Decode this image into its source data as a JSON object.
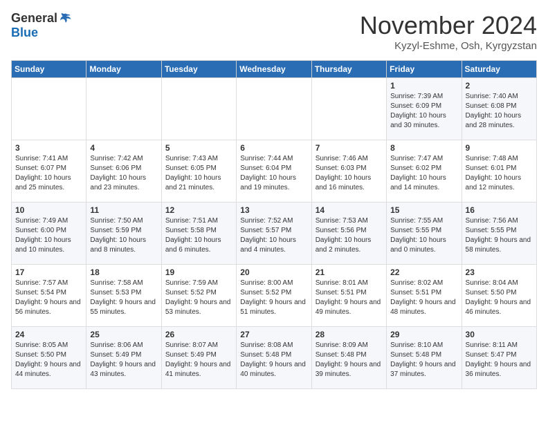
{
  "header": {
    "logo_general": "General",
    "logo_blue": "Blue",
    "title": "November 2024",
    "location": "Kyzyl-Eshme, Osh, Kyrgyzstan"
  },
  "days_of_week": [
    "Sunday",
    "Monday",
    "Tuesday",
    "Wednesday",
    "Thursday",
    "Friday",
    "Saturday"
  ],
  "weeks": [
    [
      {
        "day": "",
        "info": ""
      },
      {
        "day": "",
        "info": ""
      },
      {
        "day": "",
        "info": ""
      },
      {
        "day": "",
        "info": ""
      },
      {
        "day": "",
        "info": ""
      },
      {
        "day": "1",
        "info": "Sunrise: 7:39 AM\nSunset: 6:09 PM\nDaylight: 10 hours and 30 minutes."
      },
      {
        "day": "2",
        "info": "Sunrise: 7:40 AM\nSunset: 6:08 PM\nDaylight: 10 hours and 28 minutes."
      }
    ],
    [
      {
        "day": "3",
        "info": "Sunrise: 7:41 AM\nSunset: 6:07 PM\nDaylight: 10 hours and 25 minutes."
      },
      {
        "day": "4",
        "info": "Sunrise: 7:42 AM\nSunset: 6:06 PM\nDaylight: 10 hours and 23 minutes."
      },
      {
        "day": "5",
        "info": "Sunrise: 7:43 AM\nSunset: 6:05 PM\nDaylight: 10 hours and 21 minutes."
      },
      {
        "day": "6",
        "info": "Sunrise: 7:44 AM\nSunset: 6:04 PM\nDaylight: 10 hours and 19 minutes."
      },
      {
        "day": "7",
        "info": "Sunrise: 7:46 AM\nSunset: 6:03 PM\nDaylight: 10 hours and 16 minutes."
      },
      {
        "day": "8",
        "info": "Sunrise: 7:47 AM\nSunset: 6:02 PM\nDaylight: 10 hours and 14 minutes."
      },
      {
        "day": "9",
        "info": "Sunrise: 7:48 AM\nSunset: 6:01 PM\nDaylight: 10 hours and 12 minutes."
      }
    ],
    [
      {
        "day": "10",
        "info": "Sunrise: 7:49 AM\nSunset: 6:00 PM\nDaylight: 10 hours and 10 minutes."
      },
      {
        "day": "11",
        "info": "Sunrise: 7:50 AM\nSunset: 5:59 PM\nDaylight: 10 hours and 8 minutes."
      },
      {
        "day": "12",
        "info": "Sunrise: 7:51 AM\nSunset: 5:58 PM\nDaylight: 10 hours and 6 minutes."
      },
      {
        "day": "13",
        "info": "Sunrise: 7:52 AM\nSunset: 5:57 PM\nDaylight: 10 hours and 4 minutes."
      },
      {
        "day": "14",
        "info": "Sunrise: 7:53 AM\nSunset: 5:56 PM\nDaylight: 10 hours and 2 minutes."
      },
      {
        "day": "15",
        "info": "Sunrise: 7:55 AM\nSunset: 5:55 PM\nDaylight: 10 hours and 0 minutes."
      },
      {
        "day": "16",
        "info": "Sunrise: 7:56 AM\nSunset: 5:55 PM\nDaylight: 9 hours and 58 minutes."
      }
    ],
    [
      {
        "day": "17",
        "info": "Sunrise: 7:57 AM\nSunset: 5:54 PM\nDaylight: 9 hours and 56 minutes."
      },
      {
        "day": "18",
        "info": "Sunrise: 7:58 AM\nSunset: 5:53 PM\nDaylight: 9 hours and 55 minutes."
      },
      {
        "day": "19",
        "info": "Sunrise: 7:59 AM\nSunset: 5:52 PM\nDaylight: 9 hours and 53 minutes."
      },
      {
        "day": "20",
        "info": "Sunrise: 8:00 AM\nSunset: 5:52 PM\nDaylight: 9 hours and 51 minutes."
      },
      {
        "day": "21",
        "info": "Sunrise: 8:01 AM\nSunset: 5:51 PM\nDaylight: 9 hours and 49 minutes."
      },
      {
        "day": "22",
        "info": "Sunrise: 8:02 AM\nSunset: 5:51 PM\nDaylight: 9 hours and 48 minutes."
      },
      {
        "day": "23",
        "info": "Sunrise: 8:04 AM\nSunset: 5:50 PM\nDaylight: 9 hours and 46 minutes."
      }
    ],
    [
      {
        "day": "24",
        "info": "Sunrise: 8:05 AM\nSunset: 5:50 PM\nDaylight: 9 hours and 44 minutes."
      },
      {
        "day": "25",
        "info": "Sunrise: 8:06 AM\nSunset: 5:49 PM\nDaylight: 9 hours and 43 minutes."
      },
      {
        "day": "26",
        "info": "Sunrise: 8:07 AM\nSunset: 5:49 PM\nDaylight: 9 hours and 41 minutes."
      },
      {
        "day": "27",
        "info": "Sunrise: 8:08 AM\nSunset: 5:48 PM\nDaylight: 9 hours and 40 minutes."
      },
      {
        "day": "28",
        "info": "Sunrise: 8:09 AM\nSunset: 5:48 PM\nDaylight: 9 hours and 39 minutes."
      },
      {
        "day": "29",
        "info": "Sunrise: 8:10 AM\nSunset: 5:48 PM\nDaylight: 9 hours and 37 minutes."
      },
      {
        "day": "30",
        "info": "Sunrise: 8:11 AM\nSunset: 5:47 PM\nDaylight: 9 hours and 36 minutes."
      }
    ]
  ]
}
